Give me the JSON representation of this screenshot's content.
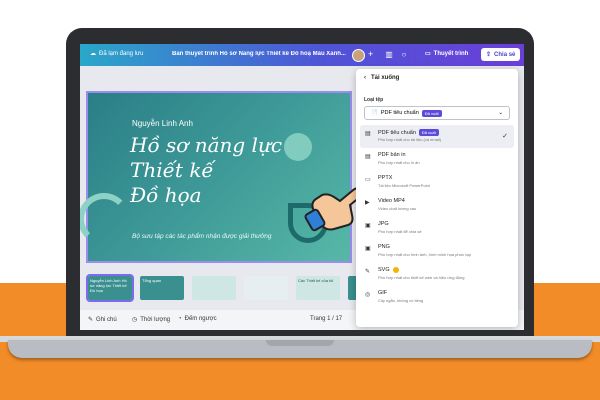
{
  "topbar": {
    "saved_label": "Đã lạm đang lưu",
    "doc_title": "Bản thuyết trình Hồ sơ Năng lực Thiết kế Đồ hoạ Màu Xanh...",
    "present_label": "Thuyết trình",
    "share_label": "Chia sẻ",
    "plus": "+"
  },
  "slide": {
    "author": "Nguyễn Linh Anh",
    "title_line1": "Hồ sơ năng lực",
    "title_line2": "Thiết kế",
    "title_line3": "Đồ họa",
    "subtitle": "Bộ sưu tập các tác phẩm nhận được giải thưởng"
  },
  "filmstrip": {
    "thumbs": [
      "Nguyễn Linh Anh Hồ sơ năng lực Thiết kế Đồ họa",
      "Tổng quan",
      "",
      "",
      "Các Thiết kế của tôi",
      ""
    ]
  },
  "bottombar": {
    "notes": "Ghi chú",
    "timer": "Thời lượng",
    "countdown": "Đếm ngược",
    "page": "Trang 1 / 17"
  },
  "download_panel": {
    "back_label": "Tải xuống",
    "file_type_label": "Loại tệp",
    "selected_value": "PDF tiêu chuẩn",
    "selected_badge": "Đã xuất",
    "options": [
      {
        "title": "PDF tiêu chuẩn",
        "badge": "Đã xuất",
        "desc": "Phù hợp nhất cho tài liệu (và email)",
        "icon": "📄"
      },
      {
        "title": "PDF bản in",
        "desc": "Phù hợp nhất cho in ấn",
        "icon": "📄"
      },
      {
        "title": "PPTX",
        "desc": "Tài liệu Microsoft PowerPoint",
        "icon": "▭"
      },
      {
        "title": "Video MP4",
        "desc": "Video chất lượng cao",
        "icon": "▶"
      },
      {
        "title": "JPG",
        "desc": "Phù hợp nhất để chia sẻ",
        "icon": "🖼"
      },
      {
        "title": "PNG",
        "desc": "Phù hợp nhất cho hình ảnh, hình minh họa phức tạp",
        "icon": "🖼"
      },
      {
        "title": "SVG",
        "desc": "Phù hợp nhất cho thiết kế web và hiệu ứng động",
        "icon": "✎"
      },
      {
        "title": "GIF",
        "desc": "Clip ngắn, không có tiếng",
        "icon": "◎"
      }
    ]
  },
  "colors": {
    "topbar_start": "#2aa7c9",
    "topbar_end": "#6a3fd9",
    "accent": "#5b4bd8",
    "slide_bg": "#3e9a98",
    "backdrop": "#f28c28"
  }
}
